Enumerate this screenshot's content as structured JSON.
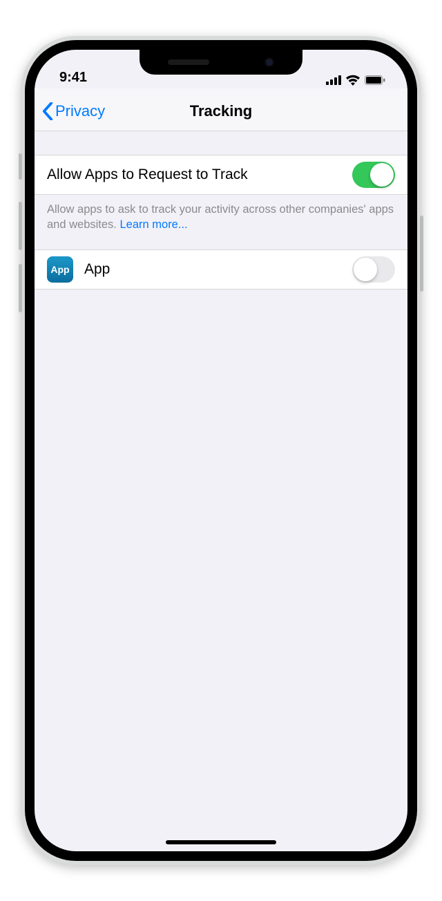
{
  "status": {
    "time": "9:41"
  },
  "nav": {
    "back_label": "Privacy",
    "title": "Tracking"
  },
  "rows": {
    "allow": {
      "label": "Allow Apps to Request to Track",
      "on": true
    },
    "app": {
      "icon_text": "App",
      "label": "App",
      "on": false
    }
  },
  "footer": {
    "text": "Allow apps to ask to track your activity across other companies' apps and websites. ",
    "link": "Learn more..."
  }
}
